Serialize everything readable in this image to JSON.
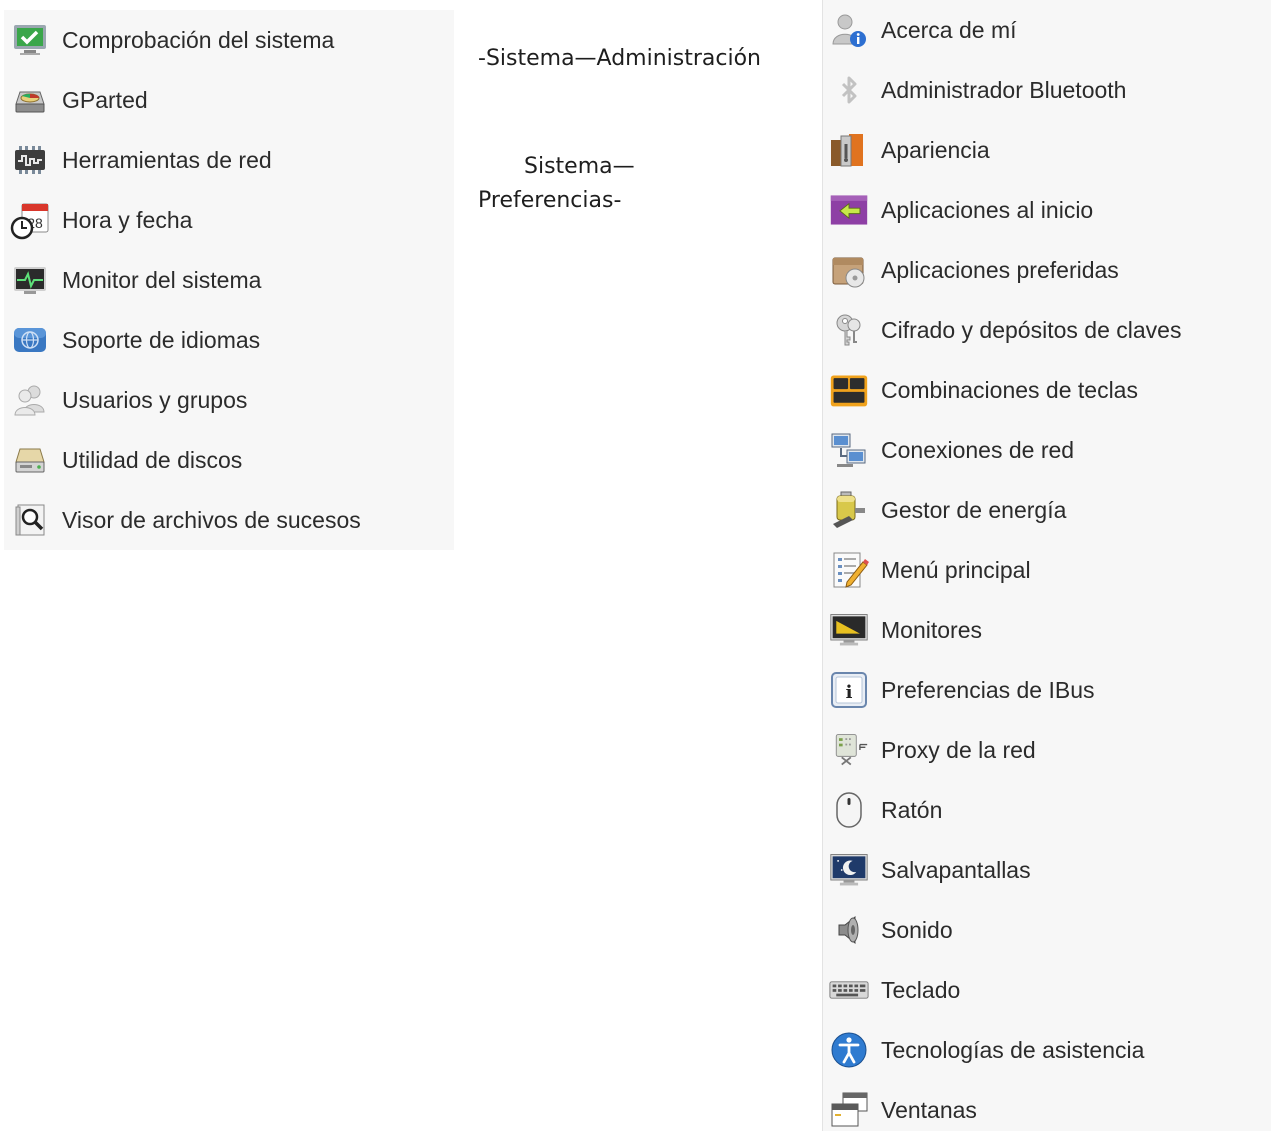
{
  "captions": {
    "admin": "-Sistema—Administración",
    "prefs_line1": "Sistema—",
    "prefs_line2": "Preferencias-"
  },
  "admin_menu": {
    "items": [
      {
        "label": "Comprobación del sistema",
        "icon": "checkmark-monitor-icon"
      },
      {
        "label": "GParted",
        "icon": "disk-partition-icon"
      },
      {
        "label": "Herramientas de red",
        "icon": "network-tools-icon"
      },
      {
        "label": "Hora y fecha",
        "icon": "calendar-clock-icon"
      },
      {
        "label": "Monitor del sistema",
        "icon": "system-monitor-icon"
      },
      {
        "label": "Soporte de idiomas",
        "icon": "language-support-icon"
      },
      {
        "label": "Usuarios y grupos",
        "icon": "users-icon"
      },
      {
        "label": "Utilidad de discos",
        "icon": "disk-utility-icon"
      },
      {
        "label": "Visor de archivos de sucesos",
        "icon": "log-viewer-icon"
      }
    ]
  },
  "prefs_menu": {
    "items": [
      {
        "label": "Acerca de mí",
        "icon": "user-info-icon"
      },
      {
        "label": "Administrador Bluetooth",
        "icon": "bluetooth-icon"
      },
      {
        "label": "Apariencia",
        "icon": "appearance-icon"
      },
      {
        "label": "Aplicaciones al inicio",
        "icon": "startup-apps-icon"
      },
      {
        "label": "Aplicaciones preferidas",
        "icon": "preferred-apps-icon"
      },
      {
        "label": "Cifrado y depósitos de claves",
        "icon": "keys-icon"
      },
      {
        "label": "Combinaciones de teclas",
        "icon": "keyboard-shortcuts-icon"
      },
      {
        "label": "Conexiones de red",
        "icon": "network-connections-icon"
      },
      {
        "label": "Gestor de energía",
        "icon": "power-manager-icon"
      },
      {
        "label": "Menú principal",
        "icon": "main-menu-editor-icon"
      },
      {
        "label": "Monitores",
        "icon": "display-icon"
      },
      {
        "label": "Preferencias de IBus",
        "icon": "ibus-info-icon"
      },
      {
        "label": "Proxy de la red",
        "icon": "network-proxy-icon"
      },
      {
        "label": "Ratón",
        "icon": "mouse-icon"
      },
      {
        "label": "Salvapantallas",
        "icon": "screensaver-icon"
      },
      {
        "label": "Sonido",
        "icon": "speaker-icon"
      },
      {
        "label": "Teclado",
        "icon": "keyboard-icon"
      },
      {
        "label": "Tecnologías de asistencia",
        "icon": "accessibility-icon"
      },
      {
        "label": "Ventanas",
        "icon": "windows-icon"
      }
    ]
  }
}
